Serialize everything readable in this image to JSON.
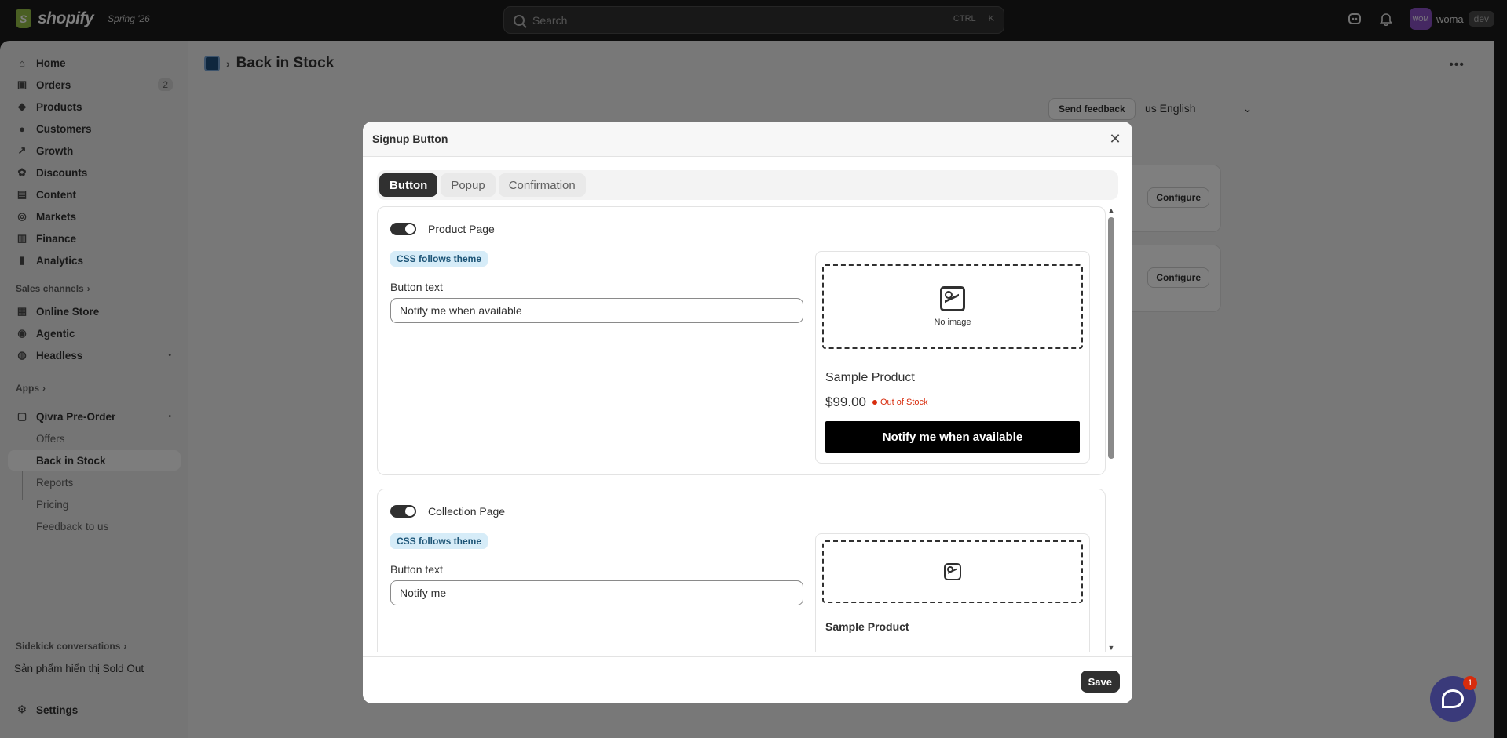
{
  "topbar": {
    "brand": "shopify",
    "edition": "Spring '26",
    "search_placeholder": "Search",
    "shortcut_ctrl": "CTRL",
    "shortcut_key": "K",
    "user_name": "woma",
    "user_initials": "WOM",
    "env_tag": "dev"
  },
  "sidebar": {
    "items": [
      {
        "label": "Home",
        "icon": "home-icon"
      },
      {
        "label": "Orders",
        "icon": "orders-icon",
        "badge": "2"
      },
      {
        "label": "Products",
        "icon": "tag-icon"
      },
      {
        "label": "Customers",
        "icon": "person-icon"
      },
      {
        "label": "Growth",
        "icon": "growth-icon"
      },
      {
        "label": "Discounts",
        "icon": "discount-icon"
      },
      {
        "label": "Content",
        "icon": "content-icon"
      },
      {
        "label": "Markets",
        "icon": "globe-icon"
      },
      {
        "label": "Finance",
        "icon": "bank-icon"
      },
      {
        "label": "Analytics",
        "icon": "chart-icon"
      }
    ],
    "sales_channels_label": "Sales channels",
    "channels": [
      {
        "label": "Online Store",
        "icon": "store-icon"
      },
      {
        "label": "Agentic",
        "icon": "agentic-icon"
      },
      {
        "label": "Headless",
        "icon": "headless-icon"
      }
    ],
    "apps_label": "Apps",
    "app_name": "Qivra Pre-Order",
    "app_subitems": [
      "Offers",
      "Back in Stock",
      "Reports",
      "Pricing",
      "Feedback to us"
    ],
    "sidekick_label": "Sidekick conversations",
    "sidekick_item": "Sản phẩm hiển thị Sold Out",
    "settings_label": "Settings"
  },
  "main": {
    "page_title": "Back in Stock",
    "send_feedback": "Send feedback",
    "language": "us English",
    "configure_label": "Configure"
  },
  "modal": {
    "title": "Signup Button",
    "tabs": [
      "Button",
      "Popup",
      "Confirmation"
    ],
    "save_label": "Save",
    "product_section": {
      "label": "Product Page",
      "css_pill": "CSS follows theme",
      "field_label": "Button text",
      "field_value": "Notify me when available",
      "preview": {
        "no_image": "No image",
        "product_name": "Sample Product",
        "price": "$99.00",
        "stock_status": "Out of Stock",
        "button_label": "Notify me when available"
      }
    },
    "collection_section": {
      "label": "Collection Page",
      "css_pill": "CSS follows theme",
      "field_label": "Button text",
      "field_value": "Notify me",
      "preview": {
        "product_name": "Sample Product"
      }
    }
  },
  "chat": {
    "badge_count": "1"
  },
  "colors": {
    "topbar_bg": "#1a1a1a",
    "sidebar_bg": "#ebebeb",
    "primary_button": "#303030",
    "out_of_stock": "#d72c0d",
    "css_pill_bg": "#d6ecf8",
    "chat_bubble": "#3a3a7a"
  }
}
